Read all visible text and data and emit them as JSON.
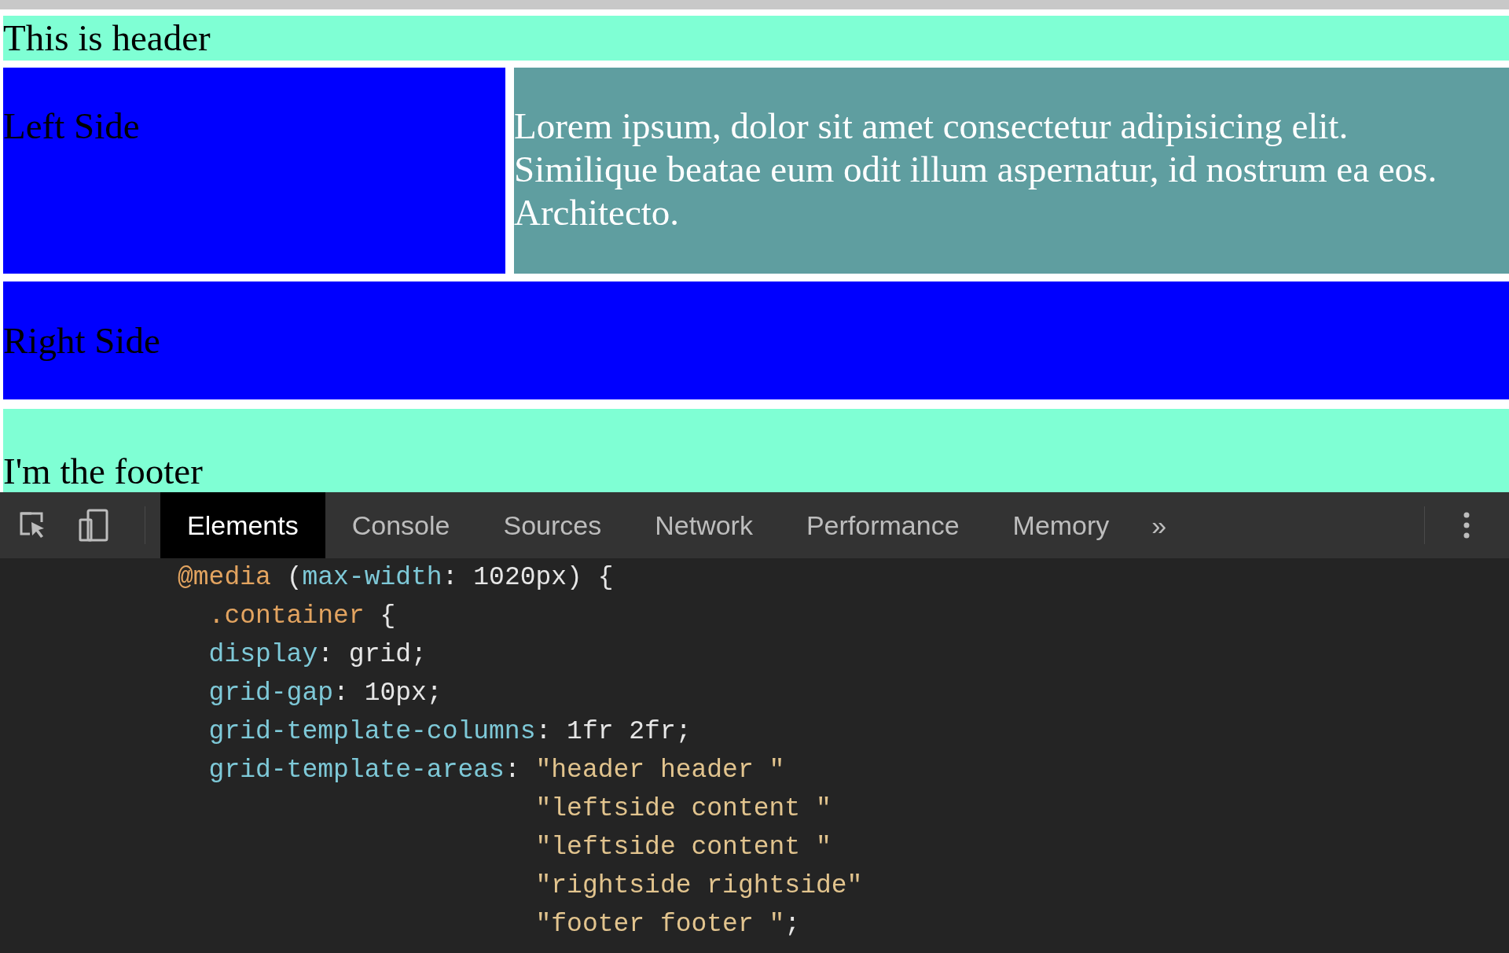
{
  "page": {
    "header": "This is header",
    "left_side": "Left Side",
    "content": "Lorem ipsum, dolor sit amet consectetur adipisicing elit. Similique beatae eum odit illum aspernatur, id nostrum ea eos. Architecto.",
    "right_side": "Right Side",
    "footer": "I'm the footer"
  },
  "devtools": {
    "tabs": [
      {
        "label": "Elements",
        "selected": true
      },
      {
        "label": "Console",
        "selected": false
      },
      {
        "label": "Sources",
        "selected": false
      },
      {
        "label": "Network",
        "selected": false
      },
      {
        "label": "Performance",
        "selected": false
      },
      {
        "label": "Memory",
        "selected": false
      }
    ],
    "more": "»",
    "code_lines": [
      [
        {
          "kind": "atrule",
          "text": "@media"
        },
        {
          "kind": "plain",
          "text": " ("
        },
        {
          "kind": "property",
          "text": "max-width"
        },
        {
          "kind": "plain",
          "text": ": 1020px) {"
        }
      ],
      [
        {
          "kind": "selector",
          "text": "  .container"
        },
        {
          "kind": "plain",
          "text": " {"
        }
      ],
      [
        {
          "kind": "property",
          "text": "  display"
        },
        {
          "kind": "plain",
          "text": ": grid;"
        }
      ],
      [
        {
          "kind": "property",
          "text": "  grid-gap"
        },
        {
          "kind": "plain",
          "text": ": 10px;"
        }
      ],
      [
        {
          "kind": "property",
          "text": "  grid-template-columns"
        },
        {
          "kind": "plain",
          "text": ": 1fr 2fr;"
        }
      ],
      [
        {
          "kind": "property",
          "text": "  grid-template-areas"
        },
        {
          "kind": "plain",
          "text": ": "
        },
        {
          "kind": "string",
          "text": "\"header header \""
        }
      ],
      [
        {
          "kind": "string",
          "text": "                       \"leftside content \""
        }
      ],
      [
        {
          "kind": "string",
          "text": "                       \"leftside content \""
        }
      ],
      [
        {
          "kind": "string",
          "text": "                       \"rightside rightside\""
        }
      ],
      [
        {
          "kind": "string",
          "text": "                       \"footer footer \""
        },
        {
          "kind": "plain",
          "text": ";"
        }
      ]
    ]
  }
}
